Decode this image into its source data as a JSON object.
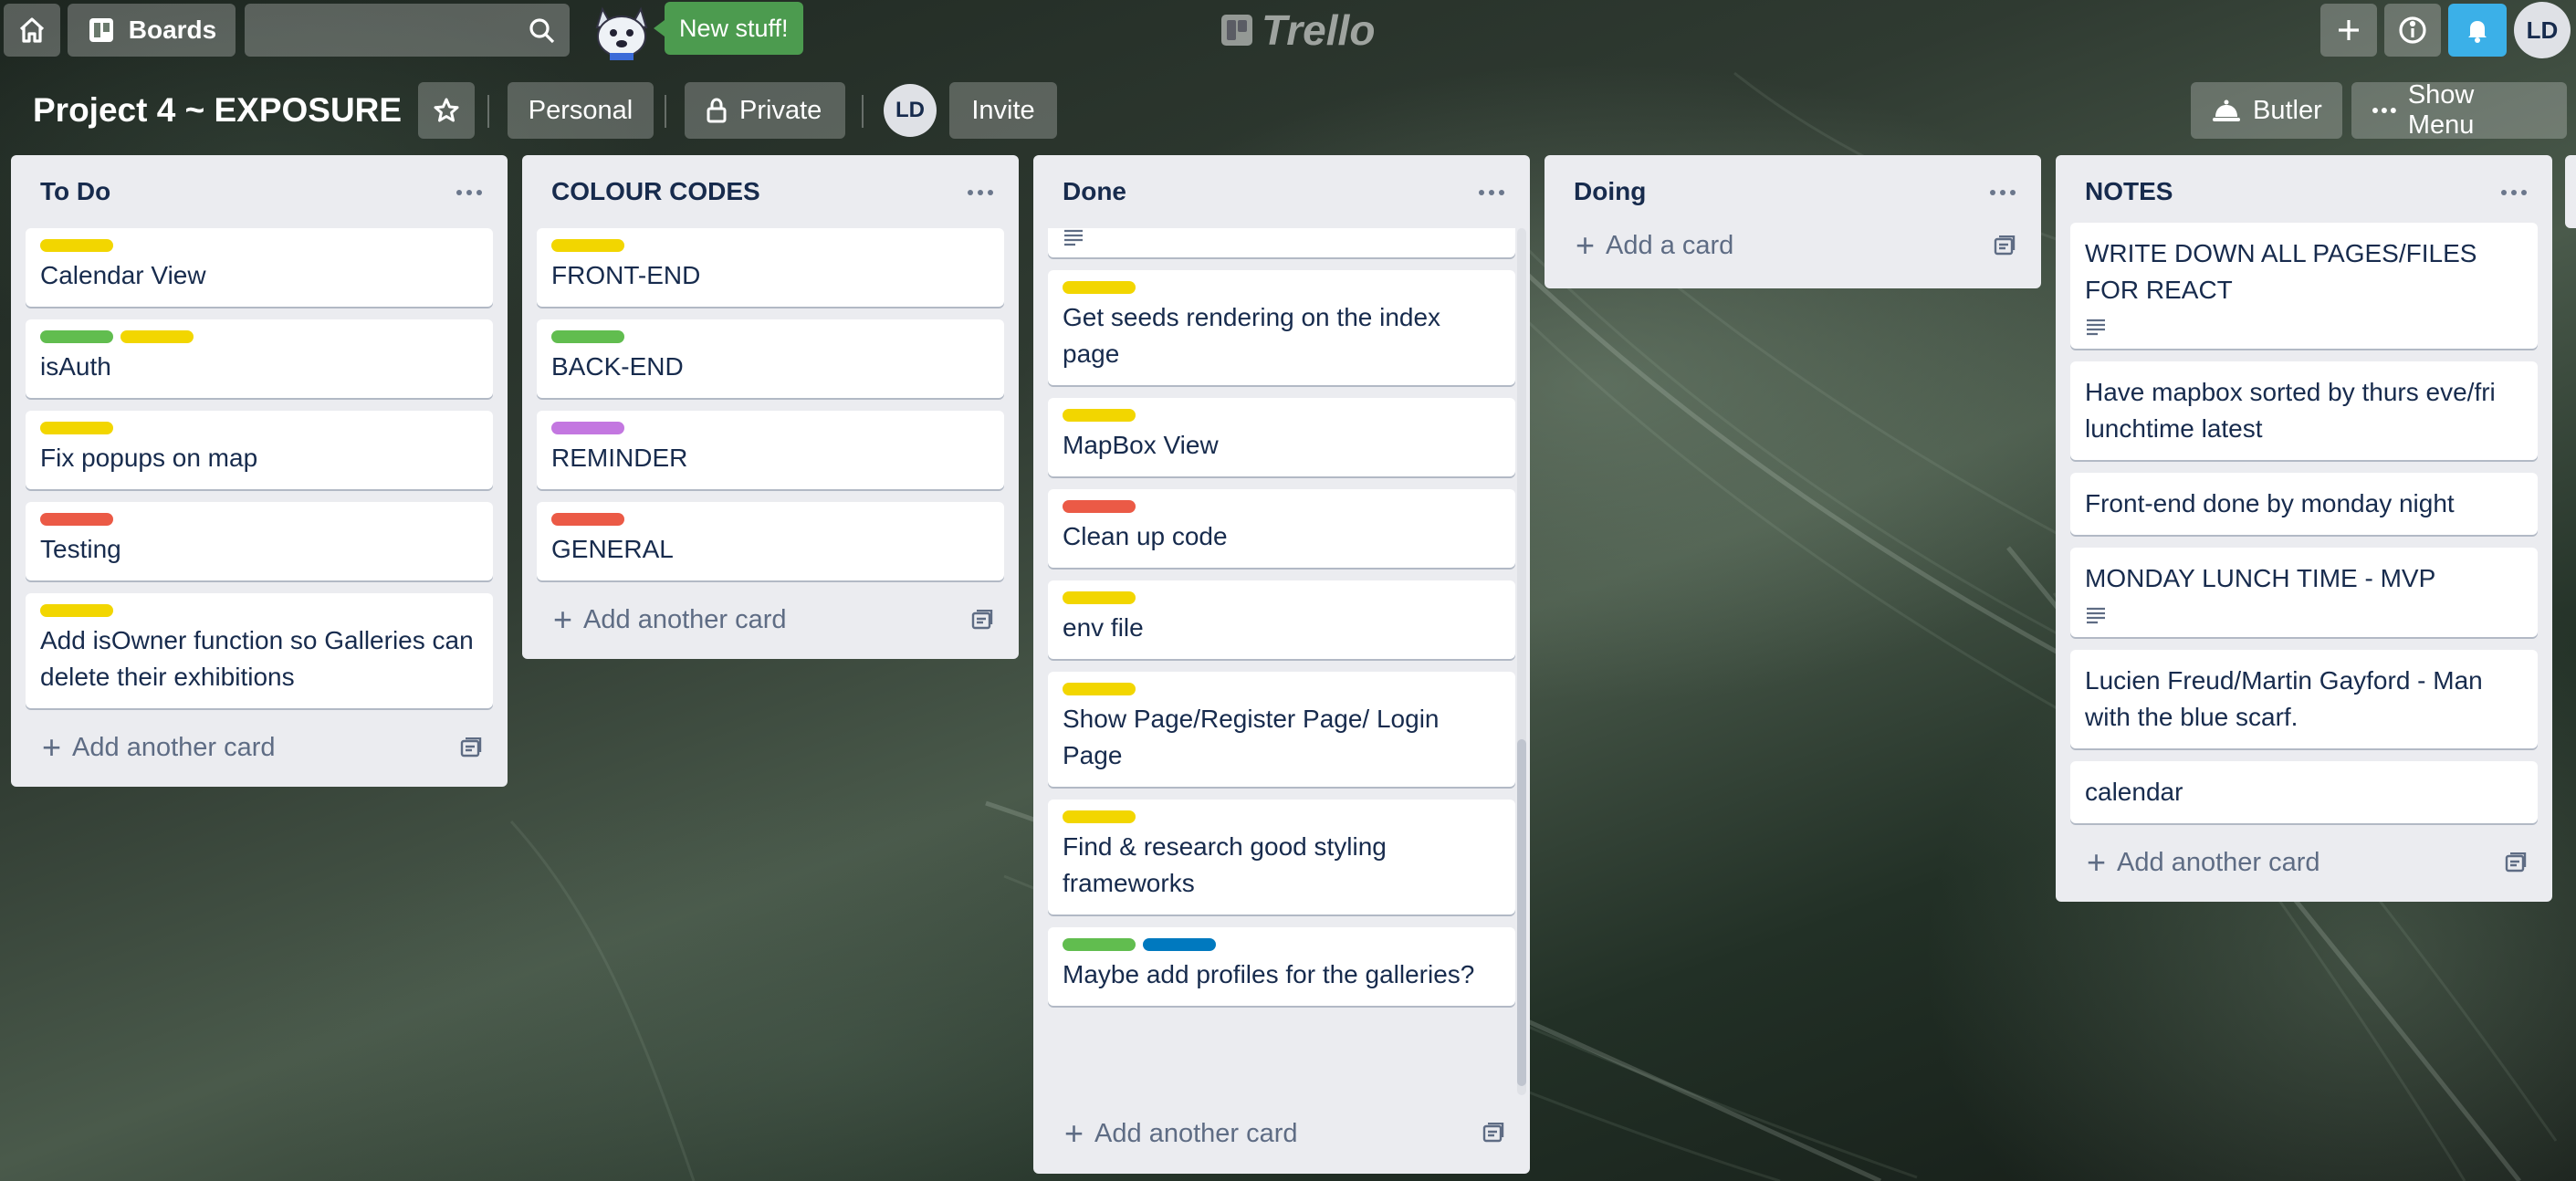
{
  "header": {
    "boards_label": "Boards",
    "new_stuff_label": "New stuff!",
    "logo_text": "Trello",
    "user_initials": "LD"
  },
  "board": {
    "title": "Project 4 ~ EXPOSURE",
    "workspace_label": "Personal",
    "visibility_label": "Private",
    "member_initials": "LD",
    "invite_label": "Invite",
    "butler_label": "Butler",
    "menu_label": "Show Menu"
  },
  "colors": {
    "yellow": "#f2d600",
    "green": "#61bd4f",
    "red": "#eb5a46",
    "purple": "#c377e0",
    "blue": "#0079bf"
  },
  "lists": [
    {
      "title": "To Do",
      "cards": [
        {
          "labels": [
            "yellow"
          ],
          "title": "Calendar View"
        },
        {
          "labels": [
            "green",
            "yellow"
          ],
          "title": "isAuth"
        },
        {
          "labels": [
            "yellow"
          ],
          "title": "Fix popups on map"
        },
        {
          "labels": [
            "red"
          ],
          "title": "Testing"
        },
        {
          "labels": [
            "yellow"
          ],
          "title": "Add isOwner function so Galleries can delete their exhibitions"
        }
      ],
      "add_label": "Add another card"
    },
    {
      "title": "COLOUR CODES",
      "cards": [
        {
          "labels": [
            "yellow"
          ],
          "title": "FRONT-END"
        },
        {
          "labels": [
            "green"
          ],
          "title": "BACK-END"
        },
        {
          "labels": [
            "purple"
          ],
          "title": "REMINDER"
        },
        {
          "labels": [
            "red"
          ],
          "title": "GENERAL"
        }
      ],
      "add_label": "Add another card"
    },
    {
      "title": "Done",
      "cards": [
        {
          "labels": [],
          "title": "",
          "has_description": true
        },
        {
          "labels": [
            "yellow"
          ],
          "title": "Get seeds rendering on the index page"
        },
        {
          "labels": [
            "yellow"
          ],
          "title": "MapBox View"
        },
        {
          "labels": [
            "red"
          ],
          "title": "Clean up code"
        },
        {
          "labels": [
            "yellow"
          ],
          "title": "env file"
        },
        {
          "labels": [
            "yellow"
          ],
          "title": "Show Page/Register Page/ Login Page"
        },
        {
          "labels": [
            "yellow"
          ],
          "title": "Find & research good styling frameworks"
        },
        {
          "labels": [
            "green",
            "blue"
          ],
          "title": "Maybe add profiles for the galleries?"
        }
      ],
      "add_label": "Add another card"
    },
    {
      "title": "Doing",
      "cards": [],
      "add_label": "Add a card"
    },
    {
      "title": "NOTES",
      "cards": [
        {
          "labels": [],
          "title": "WRITE DOWN ALL PAGES/FILES FOR REACT",
          "has_description": true
        },
        {
          "labels": [],
          "title": "Have mapbox sorted by thurs eve/fri lunchtime latest"
        },
        {
          "labels": [],
          "title": "Front-end done by monday night"
        },
        {
          "labels": [],
          "title": "MONDAY LUNCH TIME - MVP",
          "has_description": true
        },
        {
          "labels": [],
          "title": "Lucien Freud/Martin Gayford - Man with the blue scarf."
        },
        {
          "labels": [],
          "title": "calendar"
        }
      ],
      "add_label": "Add another card"
    }
  ]
}
